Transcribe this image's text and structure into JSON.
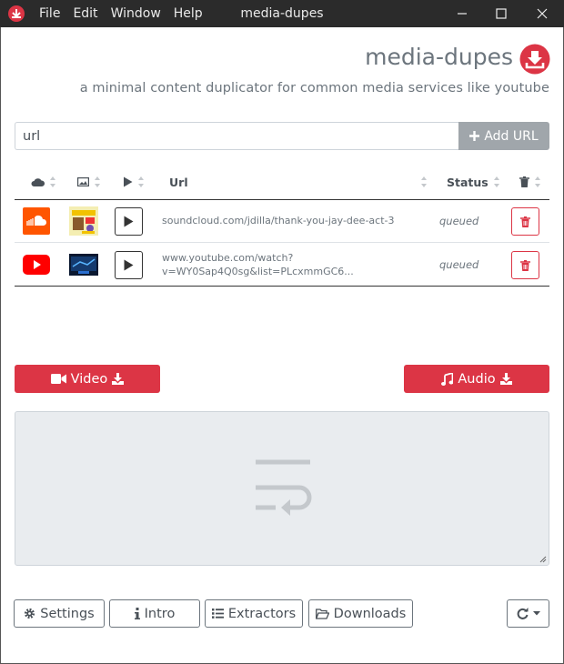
{
  "titlebar": {
    "title": "media-dupes",
    "menu": [
      "File",
      "Edit",
      "Window",
      "Help"
    ]
  },
  "header": {
    "title": "media-dupes",
    "subtitle": "a minimal content duplicator for common media services like youtube"
  },
  "url_form": {
    "placeholder": "url",
    "add_label": "Add URL"
  },
  "table": {
    "col_url": "Url",
    "col_status": "Status",
    "rows": [
      {
        "service": "soundcloud",
        "url": "soundcloud.com/jdilla/thank-you-jay-dee-act-3",
        "status": "queued"
      },
      {
        "service": "youtube",
        "url_line1": "www.youtube.com/watch?",
        "url_line2": "v=WY0Sap4Q0sg&list=PLcxmmGC6...",
        "status": "queued"
      }
    ]
  },
  "actions": {
    "video_label": "Video",
    "audio_label": "Audio"
  },
  "footer": {
    "settings": "Settings",
    "intro": "Intro",
    "extractors": "Extractors",
    "downloads": "Downloads"
  },
  "colors": {
    "accent": "#dc3545",
    "titlebar": "#2b2b2b",
    "log_bg": "#e9ecef"
  }
}
